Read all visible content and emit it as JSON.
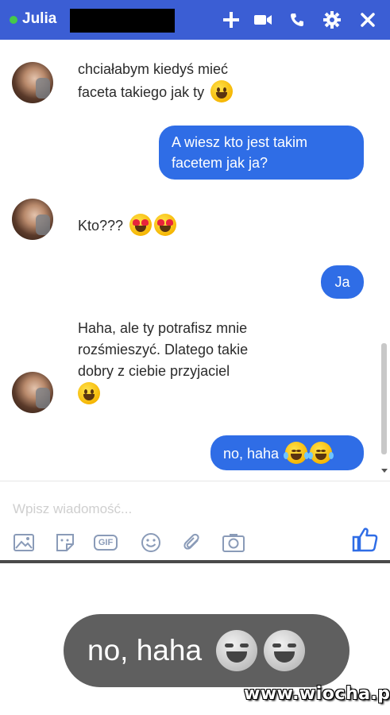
{
  "header": {
    "contact_name": "Julia",
    "status_color": "#45c84a",
    "background_color": "#3b5ed4",
    "icons": [
      "plus-icon",
      "video-camera-icon",
      "phone-icon",
      "gear-icon",
      "close-icon"
    ]
  },
  "messages": [
    {
      "from": "contact",
      "lines": [
        "chciałabym kiedyś mieć",
        "faceta takiego jak ty"
      ],
      "emoji": [
        "smiling-face"
      ]
    },
    {
      "from": "me",
      "lines": [
        "A wiesz kto jest takim",
        "facetem jak ja?"
      ]
    },
    {
      "from": "contact",
      "lines": [
        "Kto???"
      ],
      "emoji": [
        "heart-eyes",
        "heart-eyes"
      ]
    },
    {
      "from": "me",
      "lines": [
        "Ja"
      ]
    },
    {
      "from": "contact",
      "lines": [
        "Haha, ale ty potrafisz mnie",
        "rozśmieszyć. Dlatego takie",
        "dobry z ciebie przyjaciel"
      ],
      "emoji": [
        "smiling-face"
      ]
    },
    {
      "from": "me",
      "lines": [
        "no, haha"
      ],
      "emoji": [
        "tears-of-joy",
        "tears-of-joy"
      ]
    }
  ],
  "composer": {
    "placeholder": "Wpisz wiadomość...",
    "tools": [
      "image-icon",
      "sticker-icon",
      "gif-icon",
      "emoji-icon",
      "attachment-icon",
      "camera-icon"
    ],
    "gif_label": "GIF",
    "like_icon": "thumbs-up-icon"
  },
  "zoom": {
    "text": "no, haha",
    "emoji": [
      "tears-of-joy",
      "tears-of-joy"
    ]
  },
  "watermark": "www.wiocha.pl",
  "colors": {
    "outgoing_bubble": "#2f6de6",
    "zoom_bubble": "#5f5f5f"
  }
}
